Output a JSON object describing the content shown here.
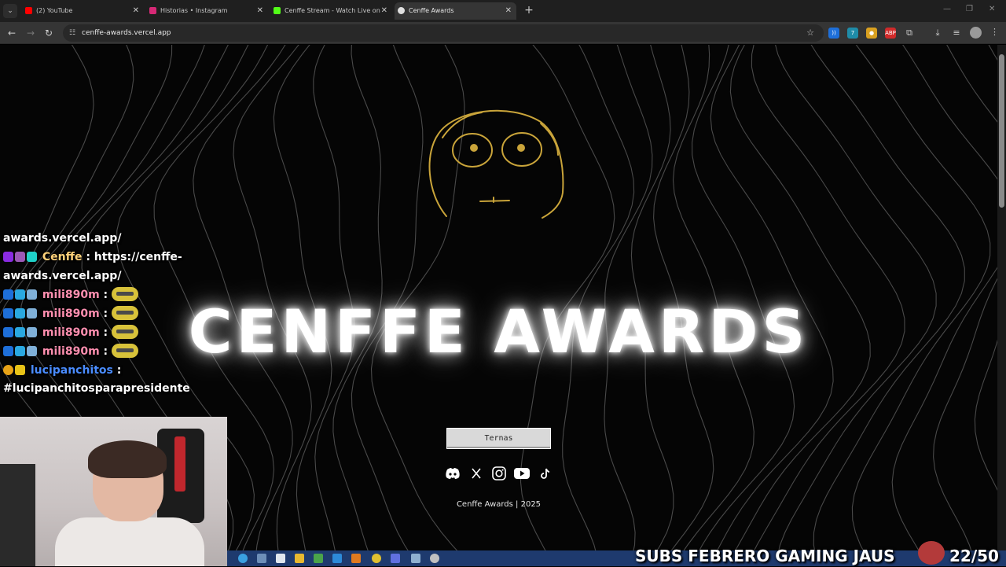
{
  "browser": {
    "tabs": [
      {
        "label": "(2) YouTube",
        "favicon_color": "#ff0000",
        "active": false
      },
      {
        "label": "Historias • Instagram",
        "favicon_color": "#d62976",
        "active": false
      },
      {
        "label": "Cenffe Stream - Watch Live on",
        "favicon_color": "#53fc18",
        "active": false
      },
      {
        "label": "Cenffe Awards",
        "favicon_color": "#e0e0e0",
        "active": true
      }
    ],
    "url": "cenffe-awards.vercel.app"
  },
  "page": {
    "title": "CENFFE AWARDS",
    "ternas_button": "Ternas",
    "socials": [
      "discord-icon",
      "x-icon",
      "instagram-icon",
      "youtube-icon",
      "tiktok-icon"
    ],
    "footer": "Cenffe Awards | 2025",
    "accent_gold": "#c9a43a"
  },
  "chat": {
    "lines": [
      {
        "user": "",
        "message": "awards.vercel.app/"
      },
      {
        "user": "Cenffe",
        "message": ": https://cenffe-"
      },
      {
        "user": "",
        "message": "awards.vercel.app/"
      },
      {
        "user": "mili890m",
        "message": ":"
      },
      {
        "user": "mili890m",
        "message": ":"
      },
      {
        "user": "mili890m",
        "message": ":"
      },
      {
        "user": "mili890m",
        "message": ":"
      },
      {
        "user": "lucipanchitos",
        "message": ":"
      },
      {
        "user": "",
        "message": "#lucipanchitosparapresidente"
      }
    ]
  },
  "overlay": {
    "subs_goal_label": "SUBS FEBRERO GAMING JAUS",
    "subs_count": "22/50"
  }
}
